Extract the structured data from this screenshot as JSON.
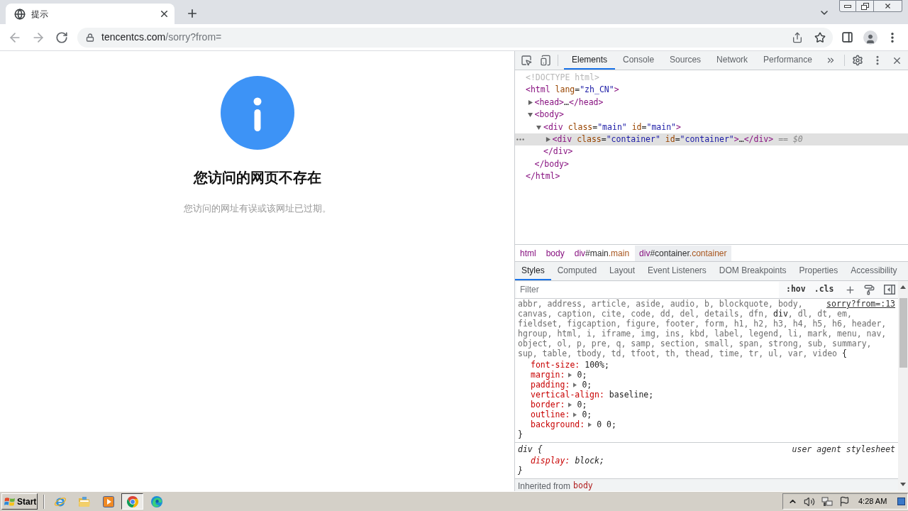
{
  "browser": {
    "tab": {
      "title": "提示"
    },
    "address": {
      "host": "tencentcs.com",
      "path": "/sorry?from="
    }
  },
  "page": {
    "heading": "您访问的网页不存在",
    "message": "您访问的网址有误或该网址已过期。"
  },
  "devtools": {
    "tabs": [
      {
        "label": "Elements",
        "selected": true
      },
      {
        "label": "Console",
        "selected": false
      },
      {
        "label": "Sources",
        "selected": false
      },
      {
        "label": "Network",
        "selected": false
      },
      {
        "label": "Performance",
        "selected": false
      }
    ],
    "dom_tree": [
      {
        "segments": [
          {
            "kind": "doctype",
            "text": "<!DOCTYPE html>"
          }
        ],
        "selected": false
      },
      {
        "segments": [
          {
            "kind": "tag",
            "text": "<html "
          },
          {
            "kind": "attr",
            "text": "lang"
          },
          {
            "kind": "plain",
            "text": "="
          },
          {
            "kind": "value",
            "text": "\"zh_CN\""
          },
          {
            "kind": "tag",
            "text": ">"
          }
        ],
        "selected": false,
        "children": [
          {
            "segments": [
              {
                "kind": "tag",
                "text": "<head>"
              },
              {
                "kind": "plain",
                "text": "…"
              },
              {
                "kind": "tag",
                "text": "</head>"
              }
            ],
            "expanded": false,
            "selected": false
          },
          {
            "segments": [
              {
                "kind": "tag",
                "text": "<body>"
              }
            ],
            "expanded": true,
            "selected": false,
            "children": [
              {
                "segments": [
                  {
                    "kind": "tag",
                    "text": "<div "
                  },
                  {
                    "kind": "attr",
                    "text": "class"
                  },
                  {
                    "kind": "plain",
                    "text": "="
                  },
                  {
                    "kind": "value",
                    "text": "\"main\""
                  },
                  {
                    "kind": "attr",
                    "text": " id"
                  },
                  {
                    "kind": "plain",
                    "text": "="
                  },
                  {
                    "kind": "value",
                    "text": "\"main\""
                  },
                  {
                    "kind": "tag",
                    "text": ">"
                  }
                ],
                "expanded": true,
                "selected": false,
                "children": [
                  {
                    "segments": [
                      {
                        "kind": "tag",
                        "text": "<div "
                      },
                      {
                        "kind": "attr",
                        "text": "class"
                      },
                      {
                        "kind": "plain",
                        "text": "="
                      },
                      {
                        "kind": "value",
                        "text": "\"container\""
                      },
                      {
                        "kind": "attr",
                        "text": " id"
                      },
                      {
                        "kind": "plain",
                        "text": "="
                      },
                      {
                        "kind": "value",
                        "text": "\"container\""
                      },
                      {
                        "kind": "tag",
                        "text": ">"
                      },
                      {
                        "kind": "plain",
                        "text": "…"
                      },
                      {
                        "kind": "tag",
                        "text": "</div>"
                      }
                    ],
                    "expanded": false,
                    "selected": true,
                    "ref": "== $0"
                  }
                ],
                "closing": "</div>"
              }
            ],
            "closing": "</body>"
          }
        ],
        "closing": "</html>"
      }
    ],
    "breadcrumbs": [
      {
        "segments": [
          {
            "kind": "tag",
            "text": "html"
          }
        ],
        "selected": false
      },
      {
        "segments": [
          {
            "kind": "tag",
            "text": "body"
          }
        ],
        "selected": false
      },
      {
        "segments": [
          {
            "kind": "tag",
            "text": "div"
          },
          {
            "kind": "id",
            "text": "#main"
          },
          {
            "kind": "class",
            "text": ".main"
          }
        ],
        "selected": false
      },
      {
        "segments": [
          {
            "kind": "tag",
            "text": "div"
          },
          {
            "kind": "id",
            "text": "#container"
          },
          {
            "kind": "class",
            "text": ".container"
          }
        ],
        "selected": true
      }
    ],
    "style_tabs": [
      {
        "label": "Styles",
        "selected": true
      },
      {
        "label": "Computed",
        "selected": false
      },
      {
        "label": "Layout",
        "selected": false
      },
      {
        "label": "Event Listeners",
        "selected": false
      },
      {
        "label": "DOM Breakpoints",
        "selected": false
      },
      {
        "label": "Properties",
        "selected": false
      },
      {
        "label": "Accessibility",
        "selected": false
      }
    ],
    "filter": {
      "placeholder": "Filter",
      "toggles": [
        ":hov",
        ".cls"
      ]
    },
    "rules": [
      {
        "kind": "author",
        "source": "sorry?from=:13",
        "selector": [
          {
            "text": "abbr, address, article, aside, audio, b, blockquote, body,",
            "matched": false
          },
          {
            "text": "canvas, caption, cite, code, dd, del, details, dfn, ",
            "matched": false
          },
          {
            "text": "div",
            "matched": true
          },
          {
            "text": ", dl, dt, em, fieldset, figcaption, figure, footer, form, h1, h2, h3, h4, h5, h6, header, hgroup, html, i, iframe, img, ins, kbd, label, legend, li, mark, menu, nav, object, ol, p, pre, q, samp, section, small, span, strong, sub, summary, sup, table, tbody, td, tfoot, th, thead, time, tr, ul, var, video",
            "matched": false
          }
        ],
        "open": "{",
        "declarations": [
          {
            "property": "font-size:",
            "value": "100%;",
            "expandable": false
          },
          {
            "property": "margin:",
            "value": "0;",
            "expandable": true
          },
          {
            "property": "padding:",
            "value": "0;",
            "expandable": true
          },
          {
            "property": "vertical-align:",
            "value": "baseline;",
            "expandable": false
          },
          {
            "property": "border:",
            "value": "0;",
            "expandable": true
          },
          {
            "property": "outline:",
            "value": "0;",
            "expandable": true
          },
          {
            "property": "background:",
            "value": "0 0;",
            "expandable": true
          }
        ],
        "close": "}"
      },
      {
        "kind": "user-agent",
        "source": "user agent stylesheet",
        "selector": [
          {
            "text": "div",
            "matched": true
          }
        ],
        "open": "{",
        "declarations": [
          {
            "property": "display:",
            "value": "block;",
            "expandable": false
          }
        ],
        "close": "}"
      }
    ],
    "inherited": {
      "label": "Inherited from",
      "element": "body"
    }
  },
  "taskbar": {
    "start": "Start",
    "apps": [
      {
        "selected": false
      },
      {
        "selected": false
      },
      {
        "selected": false
      },
      {
        "selected": true
      },
      {
        "selected": false
      }
    ],
    "clock": "4:28 AM"
  }
}
